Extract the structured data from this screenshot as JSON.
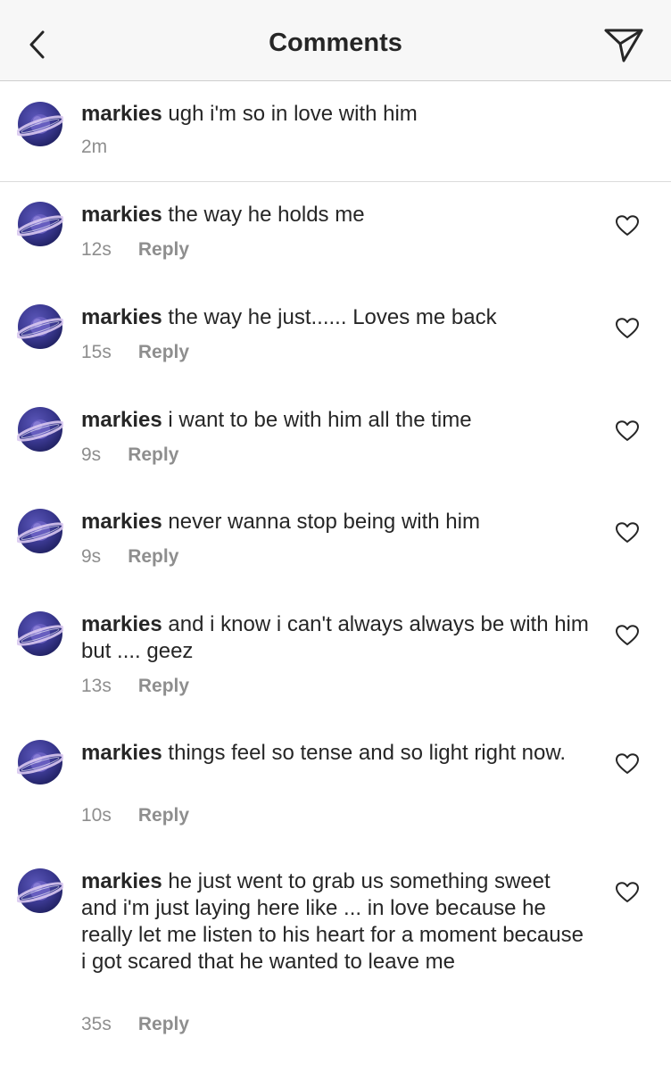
{
  "header": {
    "title": "Comments",
    "back_icon": "chevron-left-icon",
    "send_icon": "paper-plane-icon"
  },
  "caption": {
    "username": "markies",
    "text": "ugh i'm so in love with him",
    "time": "2m"
  },
  "comments": [
    {
      "username": "markies",
      "text": "the way he holds me",
      "time": "12s",
      "reply_label": "Reply"
    },
    {
      "username": "markies",
      "text": "the way he just...... Loves me back",
      "time": "15s",
      "reply_label": "Reply"
    },
    {
      "username": "markies",
      "text": "i want to be with him all the time",
      "time": "9s",
      "reply_label": "Reply"
    },
    {
      "username": "markies",
      "text": "never wanna stop being with him",
      "time": "9s",
      "reply_label": "Reply"
    },
    {
      "username": "markies",
      "text": "and i know i can't always always be with him but ....  geez",
      "time": "13s",
      "reply_label": "Reply"
    },
    {
      "username": "markies",
      "text": "things feel so tense and so light right now.",
      "time": "10s",
      "reply_label": "Reply"
    },
    {
      "username": "markies",
      "text": "he just went to grab us something sweet and i'm just laying here like ... in love because he really let me listen to his heart for a moment because i got scared that he wanted to leave me",
      "time": "35s",
      "reply_label": "Reply"
    }
  ],
  "colors": {
    "text": "#262626",
    "meta": "#8e8e8e",
    "avatar_bg": "#2e2f7a",
    "ring": "#d8c8f0"
  }
}
